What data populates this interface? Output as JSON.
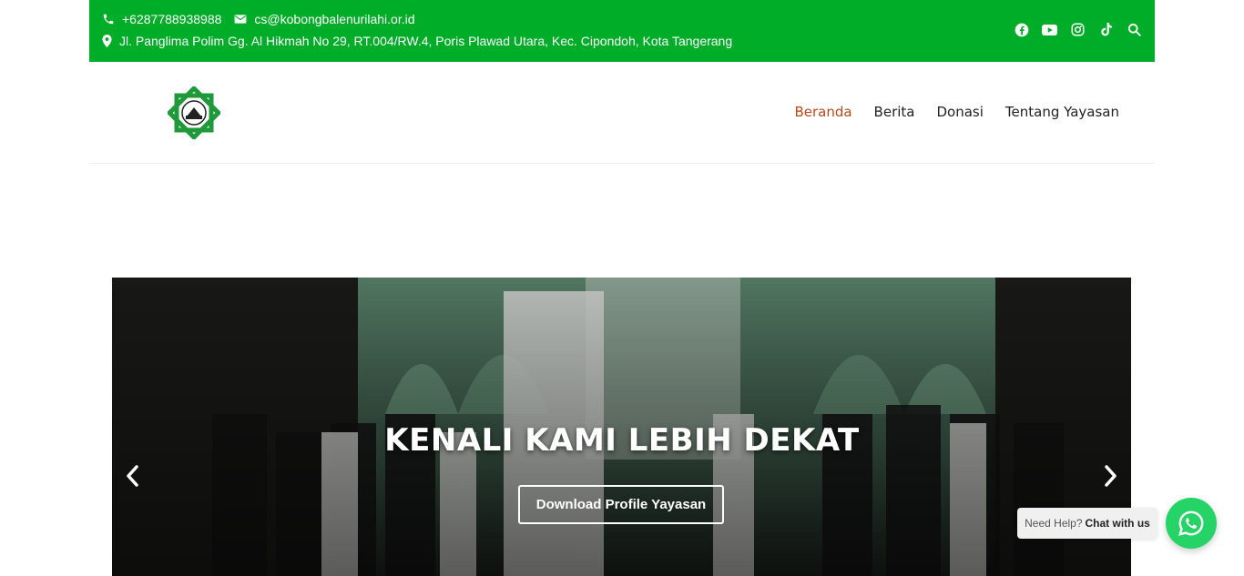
{
  "topbar": {
    "phone": "+6287788938988",
    "email": "cs@kobongbalenurilahi.or.id",
    "address": "Jl. Panglima Polim Gg. Al Hikmah No 29, RT.004/RW.4, Poris Plawad Utara, Kec. Cipondoh, Kota Tangerang",
    "social_icons": [
      "facebook-icon",
      "youtube-icon",
      "instagram-icon",
      "tiktok-icon",
      "search-icon"
    ],
    "color": "#00ad28"
  },
  "header": {
    "logo": "logo-icon",
    "nav": [
      {
        "label": "Beranda",
        "active": true
      },
      {
        "label": "Berita",
        "active": false
      },
      {
        "label": "Donasi",
        "active": false
      },
      {
        "label": "Tentang Yayasan",
        "active": false
      }
    ],
    "active_color": "#b8491e"
  },
  "slider": {
    "title": "KENALI KAMI LEBIH DEKAT",
    "button_label": "Download Profile Yayasan",
    "arrows": [
      "chevron-left-icon",
      "chevron-right-icon"
    ]
  },
  "whatsapp": {
    "prefix": "Need Help?",
    "label": "Chat with us",
    "color": "#25d366"
  }
}
